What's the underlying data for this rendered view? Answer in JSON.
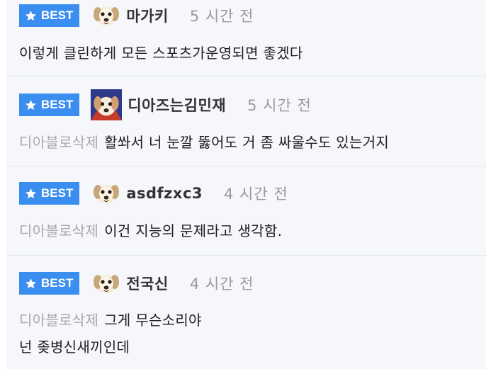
{
  "comments": [
    {
      "badge": "BEST",
      "nickname": "마가키",
      "time": "5 시간 전",
      "deleted_tag": "",
      "lines": [
        "이렇게 클린하게 모든 스포츠가운영되면 좋겠다"
      ]
    },
    {
      "badge": "BEST",
      "nickname": "디아즈는김민재",
      "time": "5 시간 전",
      "deleted_tag": "디아블로삭제",
      "lines": [
        "활쏴서 너 눈깔 뚫어도 거 좀 싸울수도 있는거지"
      ]
    },
    {
      "badge": "BEST",
      "nickname": "asdfzxc3",
      "time": "4 시간 전",
      "deleted_tag": "디아블로삭제",
      "lines": [
        "이건 지능의 문제라고 생각함."
      ]
    },
    {
      "badge": "BEST",
      "nickname": "전국신",
      "time": "4 시간 전",
      "deleted_tag": "디아블로삭제",
      "lines": [
        "그게 무슨소리야",
        "넌 좆병신새끼인데"
      ]
    }
  ],
  "colors": {
    "badge": "#3a8ef0",
    "background": "#f5f7fb",
    "muted": "#a9a9a9"
  },
  "icons": {
    "badge_icon": "star-icon",
    "avatar": "puppy-avatar-icon"
  }
}
